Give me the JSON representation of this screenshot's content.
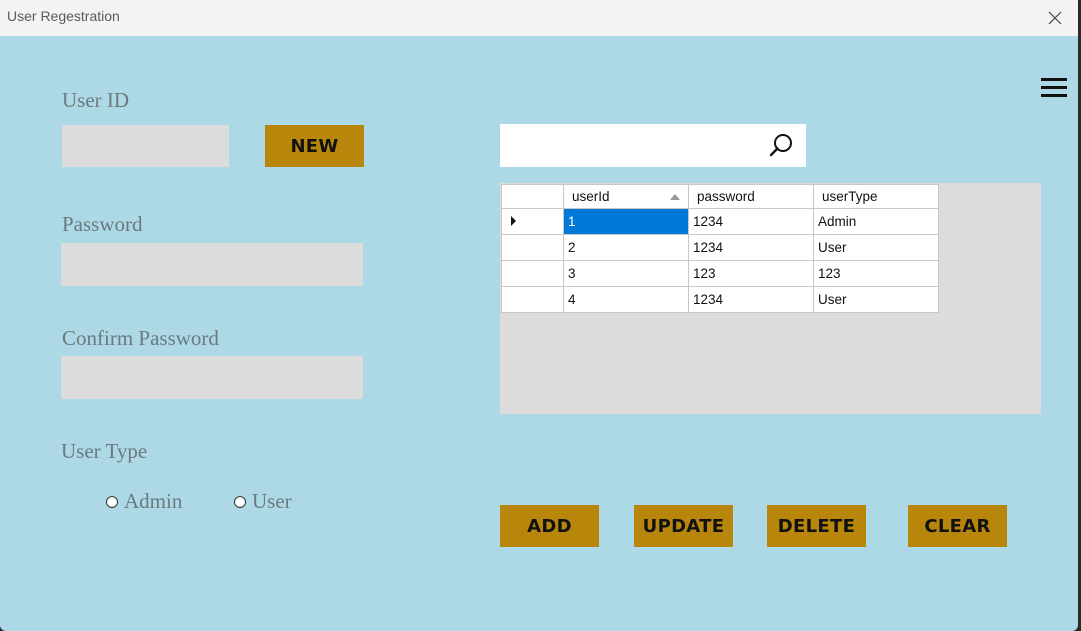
{
  "window": {
    "title": "User Regestration"
  },
  "form": {
    "user_id_label": "User ID",
    "user_id_value": "",
    "new_button": "NEW",
    "password_label": "Password",
    "password_value": "",
    "confirm_label": "Confirm Password",
    "confirm_value": "",
    "user_type_label": "User Type",
    "radio_admin": "Admin",
    "radio_user": "User"
  },
  "search": {
    "value": "",
    "placeholder": ""
  },
  "grid": {
    "columns": [
      "userId",
      "password",
      "userType"
    ],
    "sorted_column": "userId",
    "rows": [
      {
        "userId": "1",
        "password": "1234",
        "userType": "Admin"
      },
      {
        "userId": "2",
        "password": "1234",
        "userType": "User"
      },
      {
        "userId": "3",
        "password": "123",
        "userType": "123"
      },
      {
        "userId": "4",
        "password": "1234",
        "userType": "User"
      }
    ],
    "selected_row": 0
  },
  "actions": {
    "add": "ADD",
    "update": "UPDATE",
    "delete": "DELETE",
    "clear": "CLEAR"
  },
  "colors": {
    "background": "#add8e6",
    "button_gold": "#b8860b",
    "field_gray": "#dcdcdc",
    "selection_blue": "#0078d7"
  },
  "icons": {
    "close": "close-icon",
    "menu": "hamburger-menu-icon",
    "search": "search-icon",
    "row_indicator": "row-indicator-icon",
    "sort": "sort-ascending-icon"
  }
}
